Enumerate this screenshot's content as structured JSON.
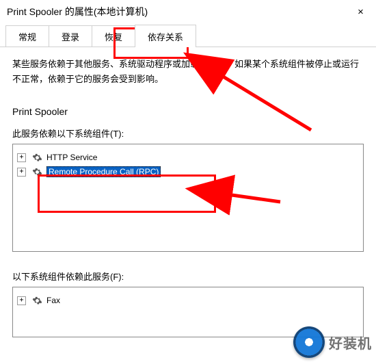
{
  "window": {
    "title": "Print Spooler 的属性(本地计算机)",
    "close_label": "×"
  },
  "tabs": [
    {
      "label": "常规"
    },
    {
      "label": "登录"
    },
    {
      "label": "恢复"
    },
    {
      "label": "依存关系"
    }
  ],
  "active_tab_index": 3,
  "description": "某些服务依赖于其他服务、系统驱动程序或加载顺序组。如果某个系统组件被停止或运行不正常，依赖于它的服务会受到影响。",
  "service_name": "Print Spooler",
  "section_depends_on": "此服务依赖以下系统组件(T):",
  "depends_on": [
    {
      "label": "HTTP Service",
      "icon": "gear",
      "expandable": true,
      "selected": false
    },
    {
      "label": "Remote Procedure Call (RPC)",
      "icon": "gear",
      "expandable": true,
      "selected": true
    }
  ],
  "section_dependents": "以下系统组件依赖此服务(F):",
  "dependents": [
    {
      "label": "Fax",
      "icon": "gear",
      "expandable": true,
      "selected": false
    }
  ],
  "watermark_text": "好装机"
}
